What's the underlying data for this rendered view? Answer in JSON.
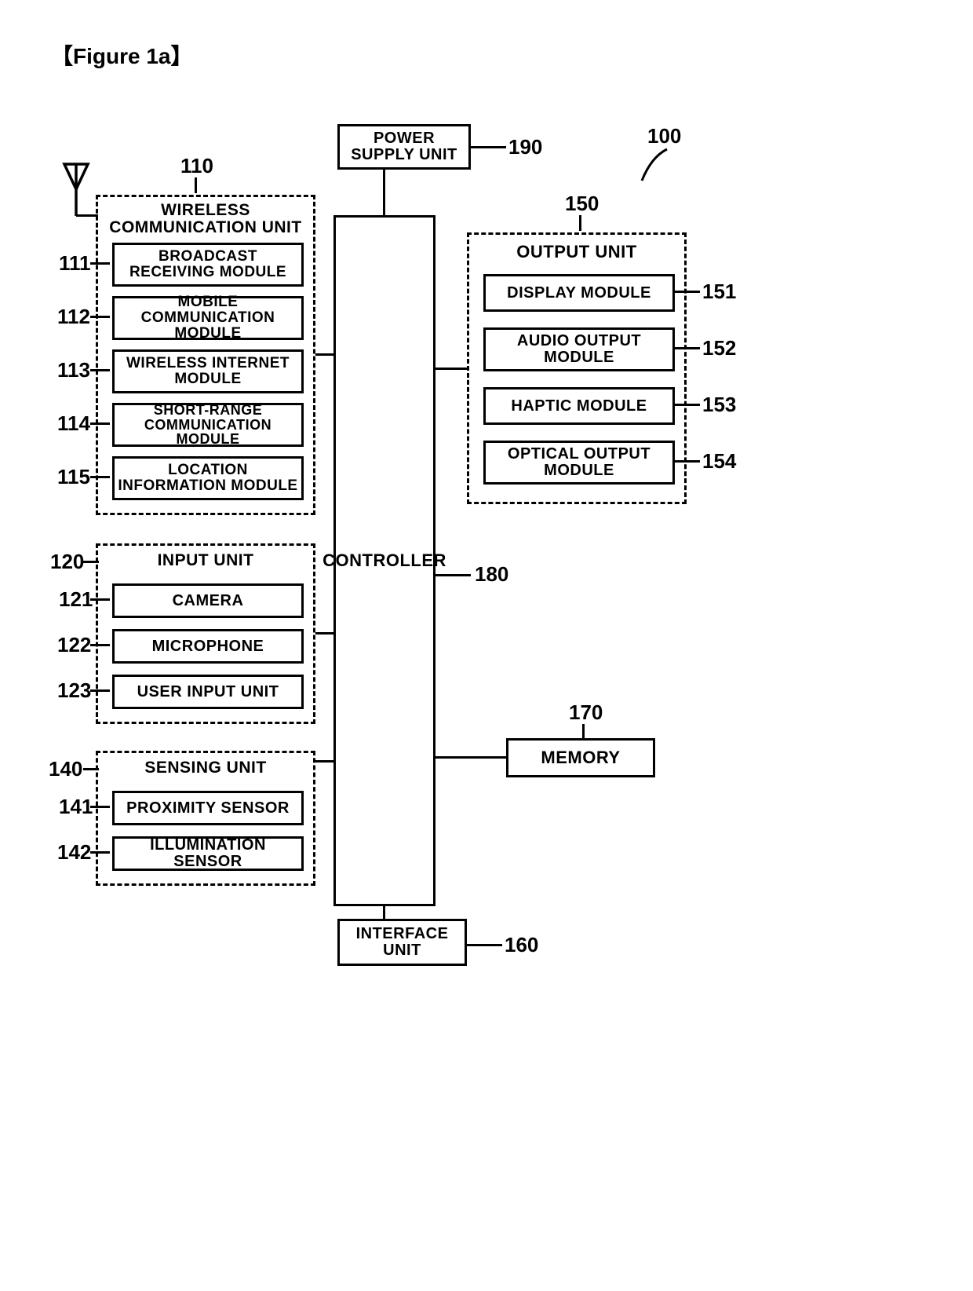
{
  "figure_label": "【Figure 1a】",
  "refs": {
    "system": "100",
    "power": "190",
    "wcu": "110",
    "wcu_items": [
      "111",
      "112",
      "113",
      "114",
      "115"
    ],
    "input": "120",
    "input_items": [
      "121",
      "122",
      "123"
    ],
    "sensing": "140",
    "sensing_items": [
      "141",
      "142"
    ],
    "output": "150",
    "output_items": [
      "151",
      "152",
      "153",
      "154"
    ],
    "controller": "180",
    "memory": "170",
    "interface": "160"
  },
  "power_supply": "POWER SUPPLY UNIT",
  "controller": "CONTROLLER",
  "interface_unit": "INTERFACE UNIT",
  "memory": "MEMORY",
  "wcu": {
    "title": "WIRELESS COMMUNICATION UNIT",
    "items": [
      "BROADCAST RECEIVING MODULE",
      "MOBILE COMMUNICATION MODULE",
      "WIRELESS INTERNET MODULE",
      "SHORT-RANGE COMMUNICATION MODULE",
      "LOCATION INFORMATION MODULE"
    ]
  },
  "input": {
    "title": "INPUT UNIT",
    "items": [
      "CAMERA",
      "MICROPHONE",
      "USER INPUT UNIT"
    ]
  },
  "sensing": {
    "title": "SENSING UNIT",
    "items": [
      "PROXIMITY SENSOR",
      "ILLUMINATION SENSOR"
    ]
  },
  "output": {
    "title": "OUTPUT UNIT",
    "items": [
      "DISPLAY MODULE",
      "AUDIO OUTPUT MODULE",
      "HAPTIC MODULE",
      "OPTICAL OUTPUT MODULE"
    ]
  }
}
